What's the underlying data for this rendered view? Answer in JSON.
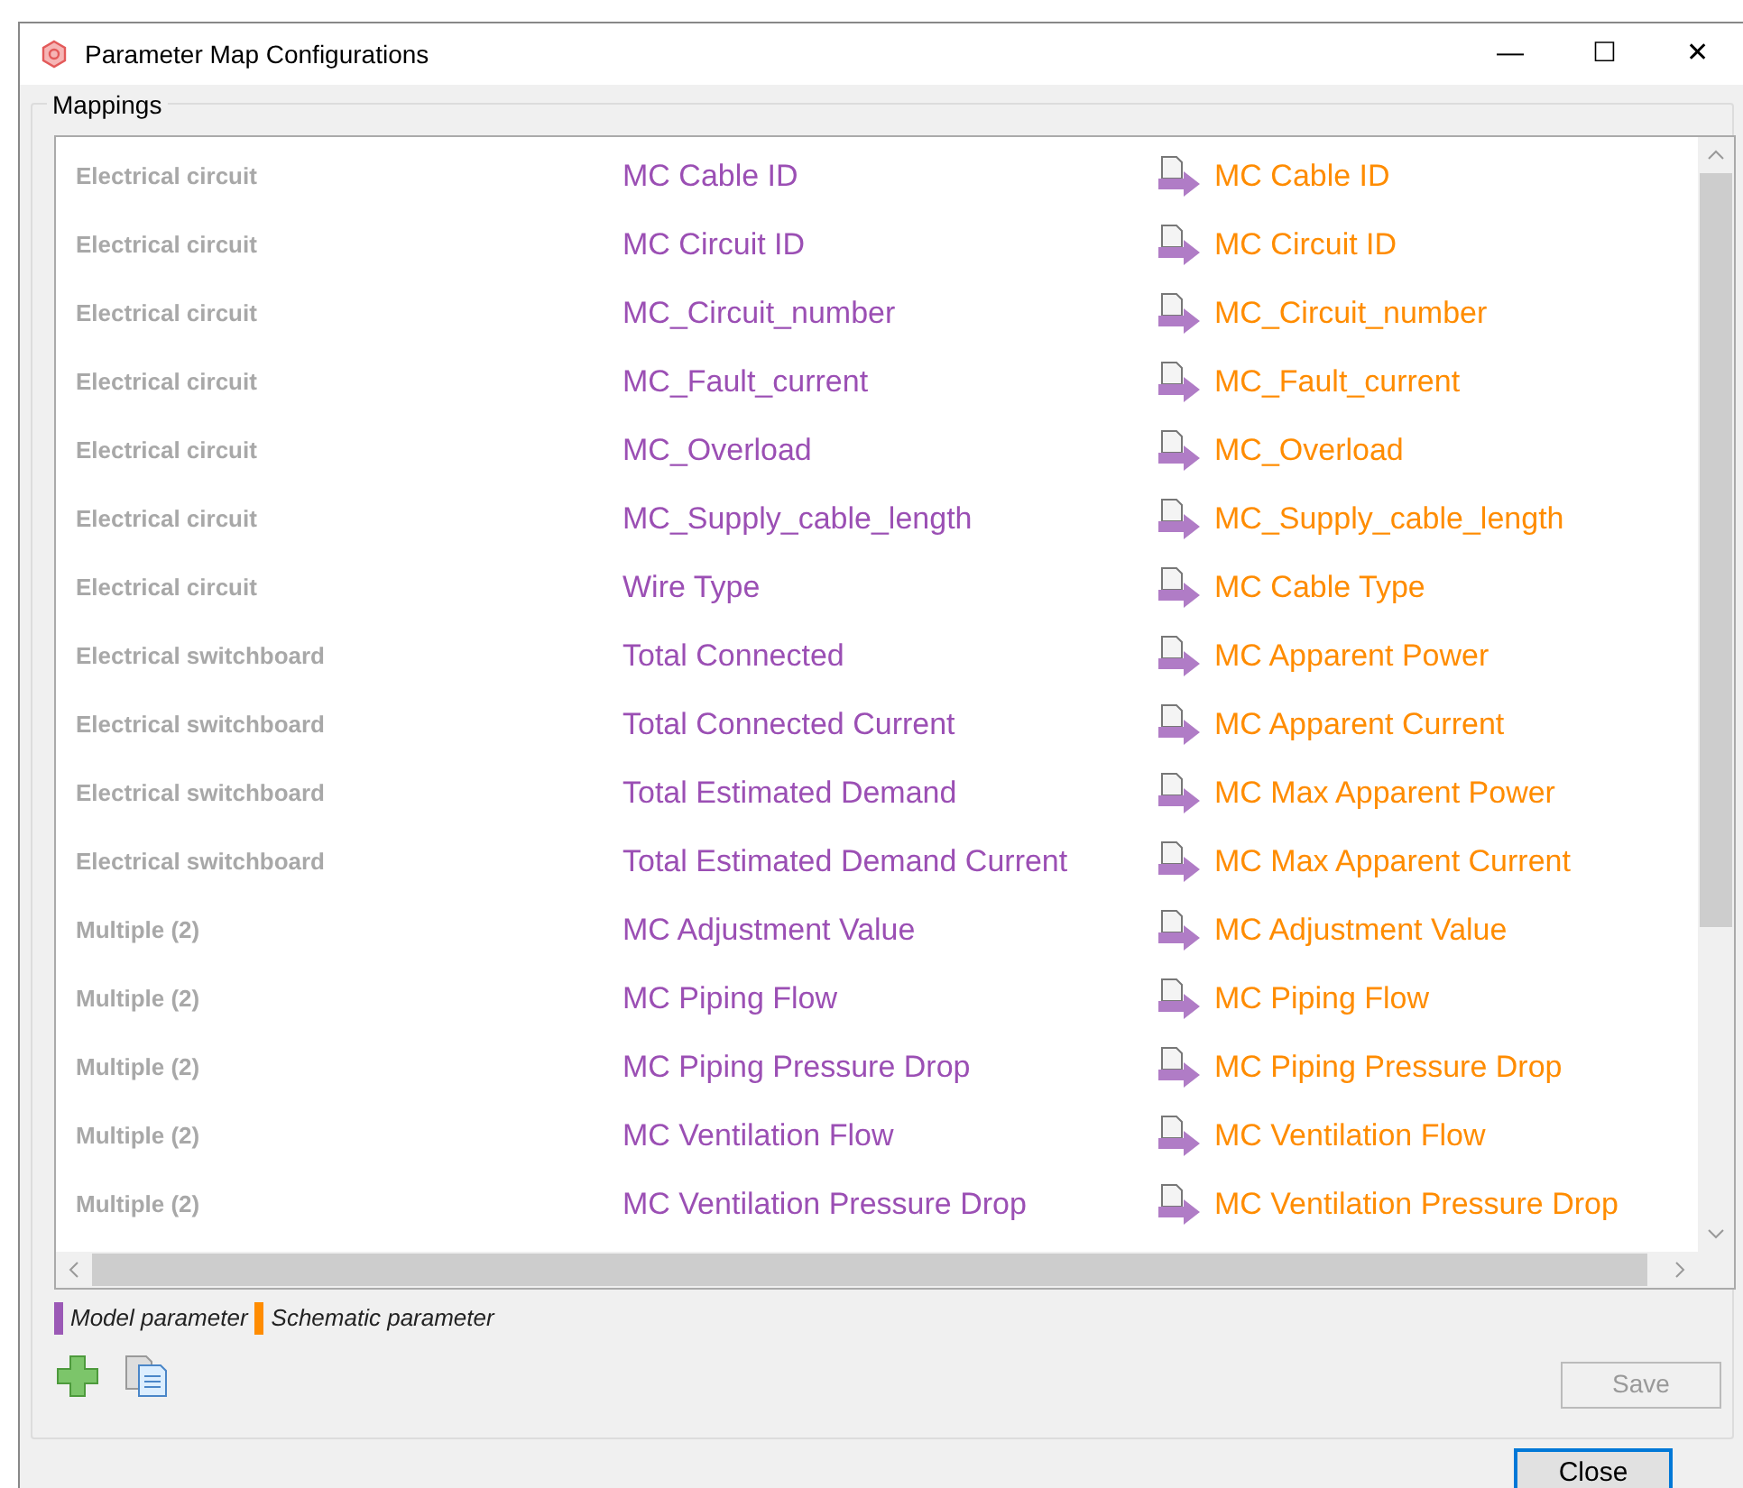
{
  "window": {
    "title": "Parameter Map Configurations",
    "controls": [
      "—",
      "☐",
      "✕"
    ]
  },
  "group": {
    "title": "Mappings"
  },
  "mappings": [
    {
      "category": "Electrical circuit",
      "model": "MC Cable ID",
      "schematic": "MC Cable ID"
    },
    {
      "category": "Electrical circuit",
      "model": "MC Circuit ID",
      "schematic": "MC Circuit ID"
    },
    {
      "category": "Electrical circuit",
      "model": "MC_Circuit_number",
      "schematic": "MC_Circuit_number"
    },
    {
      "category": "Electrical circuit",
      "model": "MC_Fault_current",
      "schematic": "MC_Fault_current"
    },
    {
      "category": "Electrical circuit",
      "model": "MC_Overload",
      "schematic": "MC_Overload"
    },
    {
      "category": "Electrical circuit",
      "model": "MC_Supply_cable_length",
      "schematic": "MC_Supply_cable_length"
    },
    {
      "category": "Electrical circuit",
      "model": "Wire Type",
      "schematic": "MC Cable Type"
    },
    {
      "category": "Electrical switchboard",
      "model": "Total Connected",
      "schematic": "MC Apparent Power"
    },
    {
      "category": "Electrical switchboard",
      "model": "Total Connected Current",
      "schematic": "MC Apparent Current"
    },
    {
      "category": "Electrical switchboard",
      "model": "Total Estimated Demand",
      "schematic": "MC Max Apparent Power"
    },
    {
      "category": "Electrical switchboard",
      "model": "Total Estimated Demand Current",
      "schematic": "MC Max Apparent Current"
    },
    {
      "category": "Multiple (2)",
      "model": "MC Adjustment Value",
      "schematic": "MC Adjustment Value"
    },
    {
      "category": "Multiple (2)",
      "model": "MC Piping Flow",
      "schematic": "MC Piping Flow"
    },
    {
      "category": "Multiple (2)",
      "model": "MC Piping Pressure Drop",
      "schematic": "MC Piping Pressure Drop"
    },
    {
      "category": "Multiple (2)",
      "model": "MC Ventilation Flow",
      "schematic": "MC Ventilation Flow"
    },
    {
      "category": "Multiple (2)",
      "model": "MC Ventilation Pressure Drop",
      "schematic": "MC Ventilation Pressure Drop"
    }
  ],
  "legend": [
    {
      "label": "Model parameter",
      "color": "#9b59b6"
    },
    {
      "label": "Schematic parameter",
      "color": "#ff8c00"
    }
  ],
  "buttons": {
    "save": {
      "label": "Save",
      "disabled": true
    },
    "close": {
      "label": "Close"
    }
  }
}
